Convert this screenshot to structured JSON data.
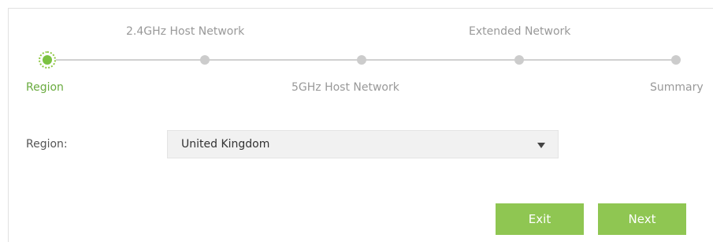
{
  "steps": [
    {
      "label": "Region",
      "state": "active"
    },
    {
      "label": "2.4GHz Host Network",
      "state": "pending"
    },
    {
      "label": "5GHz Host Network",
      "state": "pending"
    },
    {
      "label": "Extended Network",
      "state": "pending"
    },
    {
      "label": "Summary",
      "state": "pending"
    }
  ],
  "form": {
    "region_label": "Region:",
    "region_value": "United Kingdom"
  },
  "buttons": {
    "exit_label": "Exit",
    "next_label": "Next"
  },
  "colors": {
    "accent": "#8fc652",
    "active_step": "#6aab3f",
    "inactive_step": "#cccccc"
  },
  "icons": {
    "dropdown": "caret-down-icon"
  }
}
